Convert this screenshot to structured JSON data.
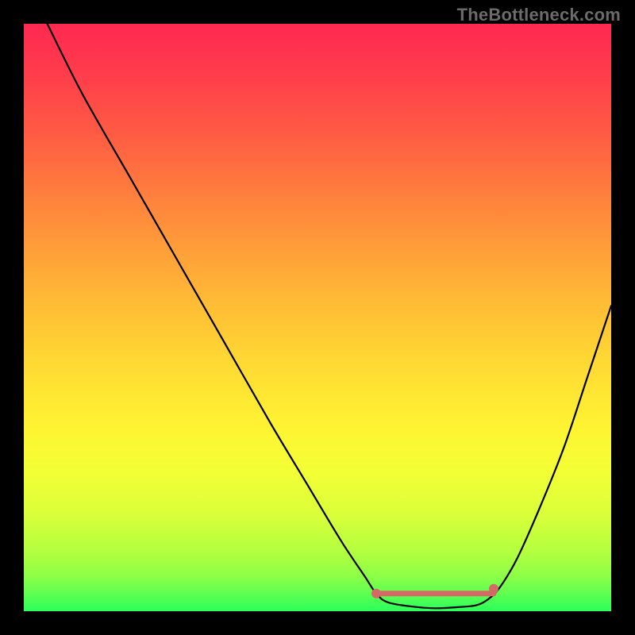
{
  "watermark": "TheBottleneck.com",
  "chart_data": {
    "type": "line",
    "title": "",
    "xlabel": "",
    "ylabel": "",
    "xlim": [
      0,
      100
    ],
    "ylim": [
      0,
      100
    ],
    "grid": false,
    "legend": false,
    "series": [
      {
        "name": "curve",
        "x": [
          4,
          10,
          18,
          26,
          34,
          42,
          48,
          54,
          58,
          60,
          62,
          66,
          70,
          74,
          77,
          79,
          81,
          84,
          88,
          92,
          96,
          100
        ],
        "y": [
          100,
          88,
          74,
          60,
          46,
          32,
          22,
          12,
          6,
          3,
          1.5,
          0.8,
          0.5,
          0.7,
          1,
          2,
          4,
          9,
          18,
          28,
          40,
          52
        ]
      }
    ],
    "highlight": {
      "name": "optimal-range",
      "x_center": 70,
      "x_halfwidth": 10,
      "y": 3,
      "color": "#d36a66"
    }
  }
}
